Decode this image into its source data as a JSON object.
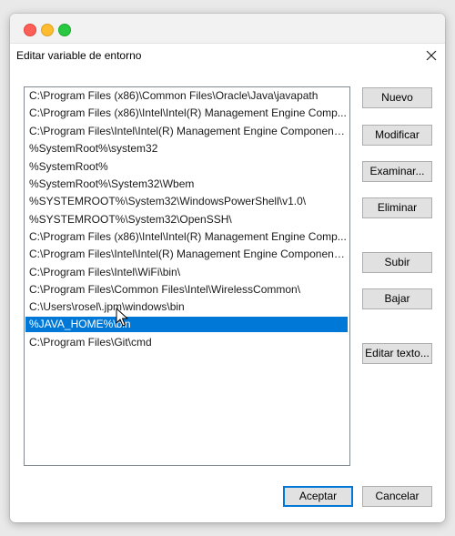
{
  "dialog": {
    "title": "Editar variable de entorno"
  },
  "paths": [
    "C:\\Program Files (x86)\\Common Files\\Oracle\\Java\\javapath",
    "C:\\Program Files (x86)\\Intel\\Intel(R) Management Engine Comp...",
    "C:\\Program Files\\Intel\\Intel(R) Management Engine Components...",
    "%SystemRoot%\\system32",
    "%SystemRoot%",
    "%SystemRoot%\\System32\\Wbem",
    "%SYSTEMROOT%\\System32\\WindowsPowerShell\\v1.0\\",
    "%SYSTEMROOT%\\System32\\OpenSSH\\",
    "C:\\Program Files (x86)\\Intel\\Intel(R) Management Engine Comp...",
    "C:\\Program Files\\Intel\\Intel(R) Management Engine Components...",
    "C:\\Program Files\\Intel\\WiFi\\bin\\",
    "C:\\Program Files\\Common Files\\Intel\\WirelessCommon\\",
    "C:\\Users\\rosel\\.jpm\\windows\\bin",
    "%JAVA_HOME%\\bin",
    "C:\\Program Files\\Git\\cmd"
  ],
  "selected_index": 13,
  "buttons": {
    "nuevo": "Nuevo",
    "modificar": "Modificar",
    "examinar": "Examinar...",
    "eliminar": "Eliminar",
    "subir": "Subir",
    "bajar": "Bajar",
    "editar_texto": "Editar texto...",
    "aceptar": "Aceptar",
    "cancelar": "Cancelar"
  },
  "colors": {
    "selection": "#0078d7",
    "primary_border": "#0078d7",
    "close_red": "#fe5f57",
    "minimize_yellow": "#febc2e",
    "zoom_green": "#28c840"
  }
}
